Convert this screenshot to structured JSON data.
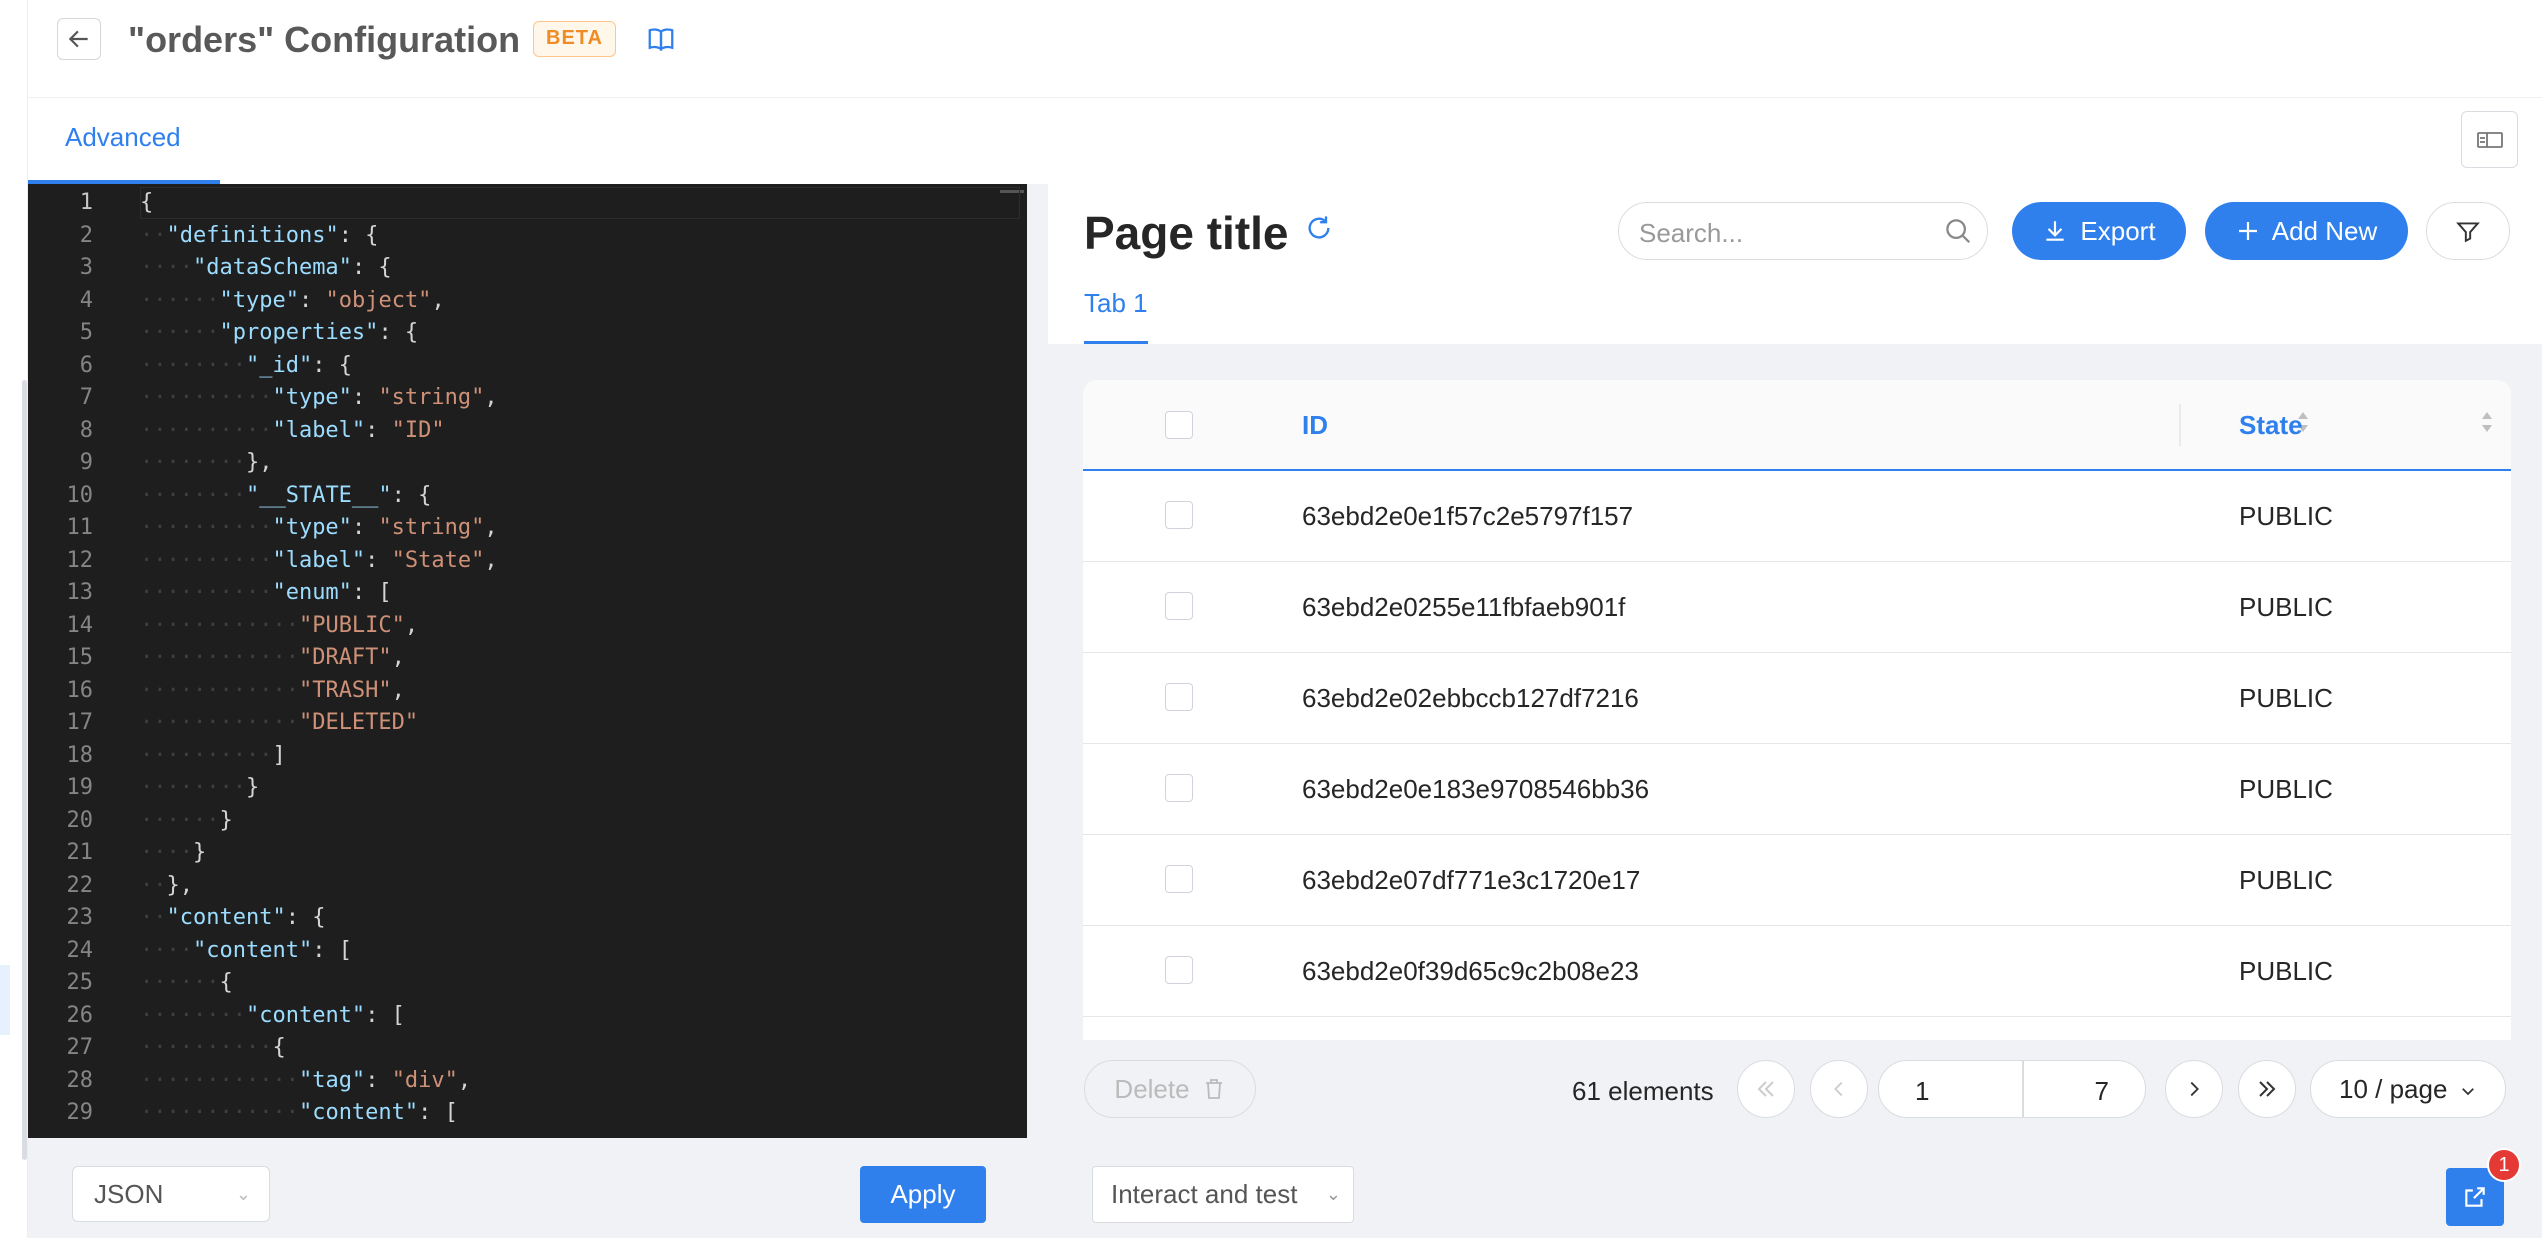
{
  "header": {
    "title": "\"orders\" Configuration",
    "badge": "BETA"
  },
  "tabs": {
    "active": "Advanced"
  },
  "editor": {
    "language_select": "JSON",
    "lines": [
      "{",
      "  \"definitions\": {",
      "    \"dataSchema\": {",
      "      \"type\": \"object\",",
      "      \"properties\": {",
      "        \"_id\": {",
      "          \"type\": \"string\",",
      "          \"label\": \"ID\"",
      "        },",
      "        \"__STATE__\": {",
      "          \"type\": \"string\",",
      "          \"label\": \"State\",",
      "          \"enum\": [",
      "            \"PUBLIC\",",
      "            \"DRAFT\",",
      "            \"TRASH\",",
      "            \"DELETED\"",
      "          ]",
      "        }",
      "      }",
      "    }",
      "  },",
      "  \"content\": {",
      "    \"content\": [",
      "      {",
      "        \"content\": [",
      "          {",
      "            \"tag\": \"div\",",
      "            \"content\": ["
    ]
  },
  "bottom": {
    "apply_label": "Apply",
    "mode_select": "Interact and test",
    "notification_count": "1"
  },
  "preview": {
    "page_title": "Page title",
    "search_placeholder": "Search...",
    "export_label": "Export",
    "add_new_label": "Add New",
    "tab1": "Tab 1",
    "table": {
      "columns": [
        "ID",
        "State"
      ],
      "rows": [
        {
          "id": "63ebd2e0e1f57c2e5797f157",
          "state": "PUBLIC"
        },
        {
          "id": "63ebd2e0255e11fbfaeb901f",
          "state": "PUBLIC"
        },
        {
          "id": "63ebd2e02ebbccb127df7216",
          "state": "PUBLIC"
        },
        {
          "id": "63ebd2e0e183e9708546bb36",
          "state": "PUBLIC"
        },
        {
          "id": "63ebd2e07df771e3c1720e17",
          "state": "PUBLIC"
        },
        {
          "id": "63ebd2e0f39d65c9c2b08e23",
          "state": "PUBLIC"
        }
      ]
    },
    "pager": {
      "delete_label": "Delete",
      "count": "61 elements",
      "current_page": "1",
      "total_pages": "7",
      "per_page": "10 / page"
    }
  },
  "colors": {
    "accent": "#2f80ed",
    "editor_bg": "#1e1e1e",
    "json_key": "#9cdcfe",
    "json_string": "#ce9178",
    "badge_text": "#f08c26"
  }
}
